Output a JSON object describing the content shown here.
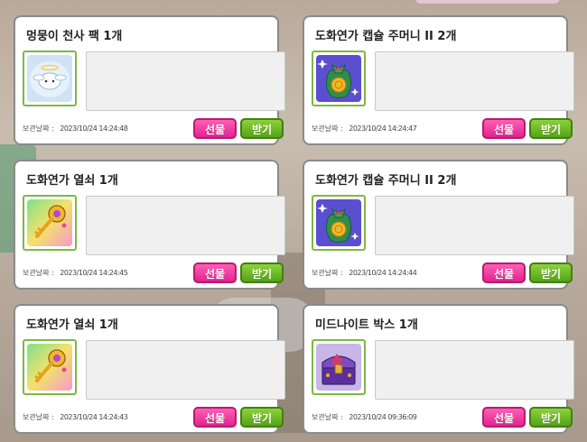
{
  "labels": {
    "date_label": "보관날짜 :",
    "gift_button": "선물",
    "receive_button": "받기"
  },
  "cards": [
    {
      "title": "멍뭉이 천사 팩 1개",
      "date": "2023/10/24 14:24:48",
      "icon": "angel-puppy-pack-icon"
    },
    {
      "title": "도화연가 캡슐 주머니 II 2개",
      "date": "2023/10/24 14:24:47",
      "icon": "capsule-pouch-icon"
    },
    {
      "title": "도화연가 열쇠 1개",
      "date": "2023/10/24 14:24:45",
      "icon": "golden-key-icon"
    },
    {
      "title": "도화연가 캡슐 주머니 II 2개",
      "date": "2023/10/24 14:24:44",
      "icon": "capsule-pouch-icon"
    },
    {
      "title": "도화연가 열쇠 1개",
      "date": "2023/10/24 14:24:43",
      "icon": "golden-key-icon"
    },
    {
      "title": "미드나이트 박스 1개",
      "date": "2023/10/24 09:36:09",
      "icon": "midnight-box-icon"
    }
  ],
  "colors": {
    "gift": "#e0248f",
    "receive": "#54a318",
    "icon_border": "#7cb944"
  }
}
